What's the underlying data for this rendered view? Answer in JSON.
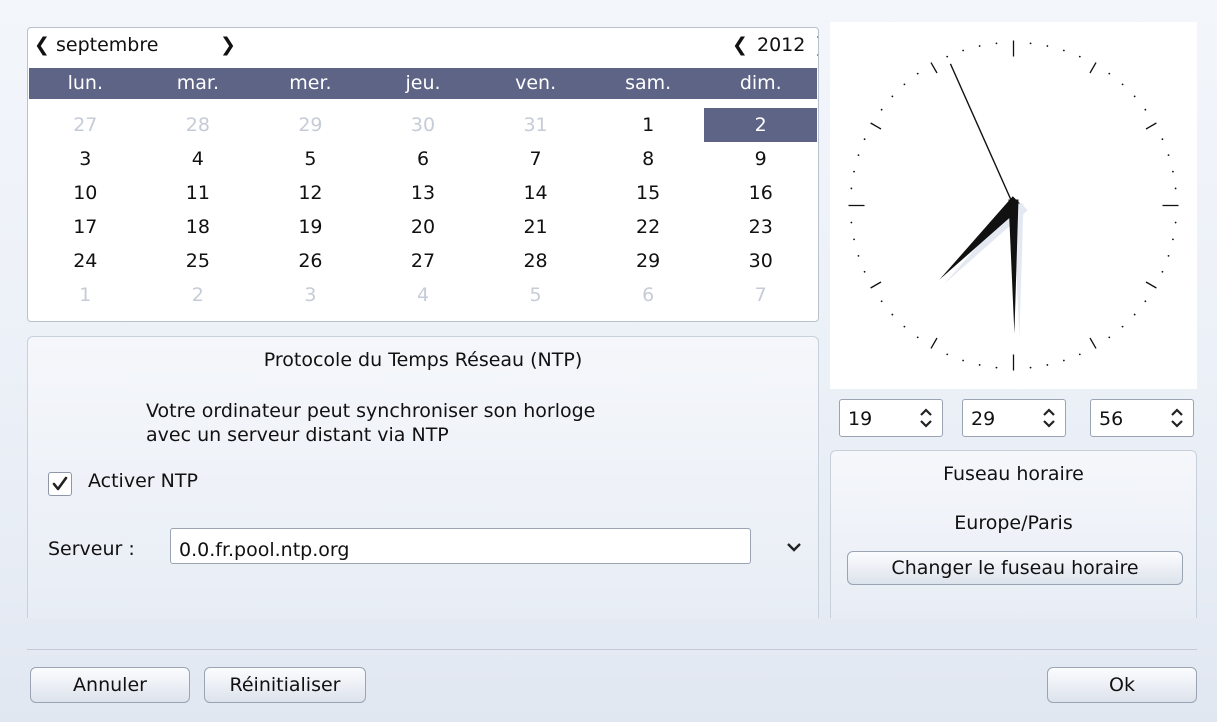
{
  "calendar": {
    "month": "septembre",
    "year": "2012",
    "weekdays": [
      "lun.",
      "mar.",
      "mer.",
      "jeu.",
      "ven.",
      "sam.",
      "dim."
    ],
    "days": [
      {
        "label": "27",
        "other": true
      },
      {
        "label": "28",
        "other": true
      },
      {
        "label": "29",
        "other": true
      },
      {
        "label": "30",
        "other": true
      },
      {
        "label": "31",
        "other": true
      },
      {
        "label": "1",
        "other": false
      },
      {
        "label": "2",
        "other": false,
        "selected": true
      },
      {
        "label": "3",
        "other": false
      },
      {
        "label": "4",
        "other": false
      },
      {
        "label": "5",
        "other": false
      },
      {
        "label": "6",
        "other": false
      },
      {
        "label": "7",
        "other": false
      },
      {
        "label": "8",
        "other": false
      },
      {
        "label": "9",
        "other": false
      },
      {
        "label": "10",
        "other": false
      },
      {
        "label": "11",
        "other": false
      },
      {
        "label": "12",
        "other": false
      },
      {
        "label": "13",
        "other": false
      },
      {
        "label": "14",
        "other": false
      },
      {
        "label": "15",
        "other": false
      },
      {
        "label": "16",
        "other": false
      },
      {
        "label": "17",
        "other": false
      },
      {
        "label": "18",
        "other": false
      },
      {
        "label": "19",
        "other": false
      },
      {
        "label": "20",
        "other": false
      },
      {
        "label": "21",
        "other": false
      },
      {
        "label": "22",
        "other": false
      },
      {
        "label": "23",
        "other": false
      },
      {
        "label": "24",
        "other": false
      },
      {
        "label": "25",
        "other": false
      },
      {
        "label": "26",
        "other": false
      },
      {
        "label": "27",
        "other": false
      },
      {
        "label": "28",
        "other": false
      },
      {
        "label": "29",
        "other": false
      },
      {
        "label": "30",
        "other": false
      },
      {
        "label": "1",
        "other": true
      },
      {
        "label": "2",
        "other": true
      },
      {
        "label": "3",
        "other": true
      },
      {
        "label": "4",
        "other": true
      },
      {
        "label": "5",
        "other": true
      },
      {
        "label": "6",
        "other": true
      },
      {
        "label": "7",
        "other": true
      }
    ]
  },
  "clock": {
    "hour": 19,
    "minute": 29,
    "second": 56
  },
  "time_spin": {
    "hours": "19",
    "minutes": "29",
    "seconds": "56"
  },
  "ntp": {
    "title": "Protocole du Temps Réseau (NTP)",
    "description_line1": "Votre ordinateur peut synchroniser son horloge",
    "description_line2": "avec un serveur distant via NTP",
    "enable_label": "Activer NTP",
    "enabled": true,
    "server_label": "Serveur :",
    "server_value": "0.0.fr.pool.ntp.org"
  },
  "timezone": {
    "title": "Fuseau horaire",
    "value": "Europe/Paris",
    "change_button": "Changer le fuseau horaire"
  },
  "footer": {
    "cancel": "Annuler",
    "reset": "Réinitialiser",
    "ok": "Ok"
  },
  "colors": {
    "accent": "#5d6486",
    "muted_day": "#c6ccd7"
  },
  "icons": {
    "prev": "chevron-left-icon",
    "next": "chevron-right-icon",
    "spin": "up-down-arrows-icon",
    "dropdown": "chevron-down-icon",
    "check": "check-icon"
  }
}
